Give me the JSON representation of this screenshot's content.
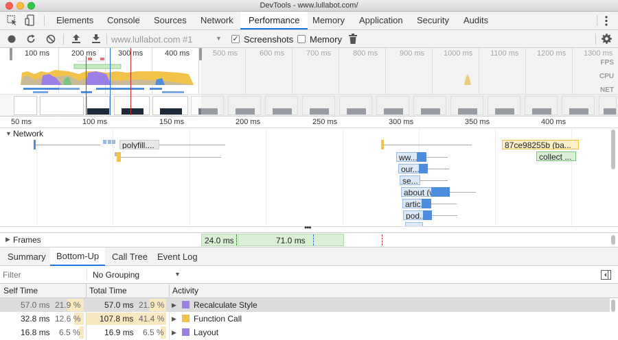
{
  "window": {
    "title": "DevTools - www.lullabot.com/"
  },
  "tabs": [
    "Elements",
    "Console",
    "Sources",
    "Network",
    "Performance",
    "Memory",
    "Application",
    "Security",
    "Audits"
  ],
  "active_tab": "Performance",
  "toolbar": {
    "recording_select": "www.lullabot.com #1",
    "screenshots_label": "Screenshots",
    "screenshots_checked": true,
    "memory_label": "Memory",
    "memory_checked": false
  },
  "overview": {
    "ticks": [
      "100 ms",
      "200 ms",
      "300 ms",
      "400 ms",
      "500 ms",
      "600 ms",
      "700 ms",
      "800 ms",
      "900 ms",
      "1000 ms",
      "1100 ms",
      "1200 ms",
      "1300 ms"
    ],
    "labels": {
      "fps": "FPS",
      "cpu": "CPU",
      "net": "NET"
    }
  },
  "ruler": {
    "ticks": [
      "50 ms",
      "100 ms",
      "150 ms",
      "200 ms",
      "250 ms",
      "300 ms",
      "350 ms",
      "400 ms"
    ]
  },
  "network": {
    "title": "Network",
    "requests": [
      "polyfill....",
      "87ce98255b (ba...",
      "collect ...",
      "ww...",
      "our...",
      "se...",
      "about (w...",
      "artic...",
      "pod...."
    ]
  },
  "frames": {
    "title": "Frames",
    "values": [
      "24.0 ms",
      "71.0 ms"
    ]
  },
  "subtabs": [
    "Summary",
    "Bottom-Up",
    "Call Tree",
    "Event Log"
  ],
  "active_subtab": "Bottom-Up",
  "filter": {
    "placeholder": "Filter",
    "grouping": "No Grouping"
  },
  "table": {
    "headers": {
      "self": "Self Time",
      "total": "Total Time",
      "activity": "Activity"
    },
    "rows": [
      {
        "self_ms": "57.0 ms",
        "self_pct": "21.9 %",
        "total_ms": "57.0 ms",
        "total_pct": "21.9 %",
        "activity": "Recalculate Style",
        "color": "#9b7fe6"
      },
      {
        "self_ms": "32.8 ms",
        "self_pct": "12.6 %",
        "total_ms": "107.8 ms",
        "total_pct": "41.4 %",
        "activity": "Function Call",
        "color": "#f2c34b"
      },
      {
        "self_ms": "16.8 ms",
        "self_pct": "6.5 %",
        "total_ms": "16.9 ms",
        "total_pct": "6.5 %",
        "activity": "Layout",
        "color": "#9b7fe6"
      }
    ]
  }
}
